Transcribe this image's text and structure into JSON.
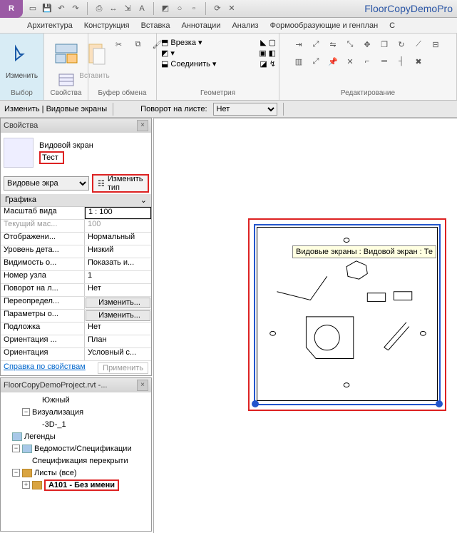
{
  "app": {
    "title": "FloorCopyDemoPro"
  },
  "menu": {
    "items": [
      "Архитектура",
      "Конструкция",
      "Вставка",
      "Аннотации",
      "Анализ",
      "Формообразующие и генплан",
      "С"
    ]
  },
  "ribbon": {
    "modify": "Изменить",
    "select_caption": "Выбор",
    "props_caption": "Свойства",
    "paste": "Вставить",
    "clip_caption": "Буфер обмена",
    "cut_label": "Врезка",
    "join_label": "Соединить",
    "geom_caption": "Геометрия",
    "edit_caption": "Редактирование"
  },
  "optbar": {
    "context": "Изменить | Видовые экраны",
    "rot_label": "Поворот на листе:",
    "rot_value": "Нет"
  },
  "props": {
    "title": "Свойства",
    "family": "Видовой экран",
    "type": "Тест",
    "selector": "Видовые экра",
    "edit_type": "Изменить тип",
    "group1": "Графика",
    "rows": [
      {
        "k": "Масштаб вида",
        "v": "1 : 100",
        "boxed": true
      },
      {
        "k": "Текущий мас...",
        "v": "100",
        "dis": true
      },
      {
        "k": "Отображени...",
        "v": "Нормальный"
      },
      {
        "k": "Уровень дета...",
        "v": "Низкий"
      },
      {
        "k": "Видимость о...",
        "v": "Показать и..."
      },
      {
        "k": "Номер узла",
        "v": "1"
      },
      {
        "k": "Поворот на л...",
        "v": "Нет"
      },
      {
        "k": "Переопредел...",
        "v": "Изменить...",
        "btn": true
      },
      {
        "k": "Параметры о...",
        "v": "Изменить...",
        "btn": true
      },
      {
        "k": "Подложка",
        "v": "Нет"
      },
      {
        "k": "Ориентация ...",
        "v": "План"
      },
      {
        "k": "Ориентация",
        "v": "Условный с..."
      }
    ],
    "help": "Справка по свойствам",
    "apply": "Применить"
  },
  "browser": {
    "title": "FloorCopyDemoProject.rvt -...",
    "nodes": {
      "south": "Южный",
      "viz": "Визуализация",
      "threed": "-3D-_1",
      "legends": "Легенды",
      "sched": "Ведомости/Спецификации",
      "sched_item": "Спецификация перекрыти",
      "sheets": "Листы (все)",
      "sheet1": "A101 - Без имени"
    }
  },
  "canvas": {
    "tooltip": "Видовые экраны : Видовой экран : Те"
  }
}
